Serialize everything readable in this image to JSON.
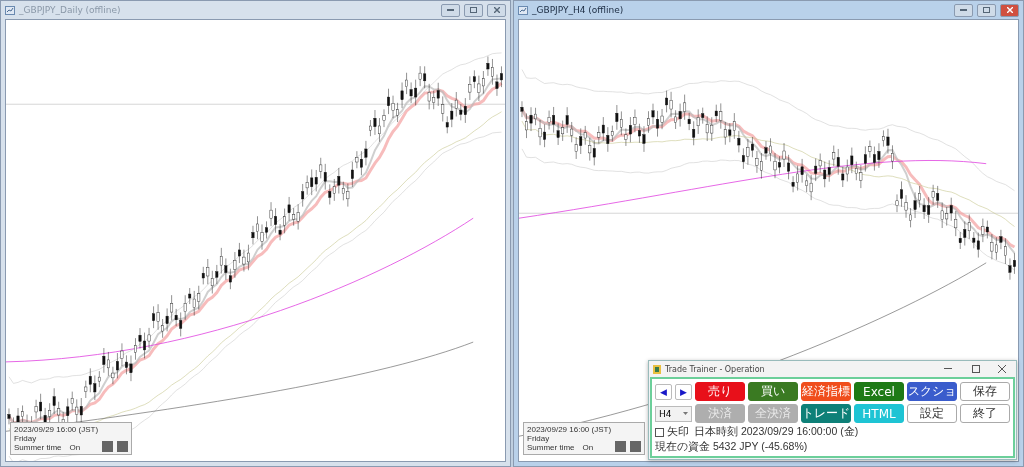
{
  "windows": [
    {
      "title": "_GBPJPY_Daily (offline)",
      "active": false,
      "info": {
        "date": "2023/09/29 16:00 (JST)",
        "day": "Friday",
        "summer_label": "Summer time",
        "summer_value": "On"
      }
    },
    {
      "title": "_GBPJPY_H4 (offline)",
      "active": true,
      "info": {
        "date": "2023/09/29 16:00 (JST)",
        "day": "Friday",
        "summer_label": "Summer time",
        "summer_value": "On"
      }
    }
  ],
  "dialog": {
    "title": "Trade Trainer - Operation",
    "nav": [
      {
        "label": "◀"
      },
      {
        "label": "▶"
      }
    ],
    "timeframe": "H4",
    "buttons": [
      {
        "label": "売り",
        "color": "#e8101a",
        "disabled": false
      },
      {
        "label": "買い",
        "color": "#3a7a22",
        "disabled": false
      },
      {
        "label": "経済指標",
        "color": "#f04e1c",
        "disabled": false
      },
      {
        "label": "Excel",
        "color": "#1e7a16",
        "disabled": false
      },
      {
        "label": "スクショ",
        "color": "#3a5ccc",
        "disabled": false
      },
      {
        "label": "保存",
        "color": "#ffffff",
        "disabled": false
      },
      {
        "label": "決済",
        "color": "#a0a0a0",
        "disabled": true
      },
      {
        "label": "全決済",
        "color": "#a0a0a0",
        "disabled": true
      },
      {
        "label": "トレード",
        "color": "#0e8078",
        "disabled": false
      },
      {
        "label": "HTML",
        "color": "#1ec4d4",
        "disabled": false
      },
      {
        "label": "設定",
        "color": "#ffffff",
        "disabled": false
      },
      {
        "label": "終了",
        "color": "#ffffff",
        "disabled": false
      }
    ],
    "arrow_checkbox": {
      "label": "矢印",
      "checked": false
    },
    "time_text": "日本時刻 2023/09/29 16:00:00 (金)",
    "funds_text": "現在の資金 5432 JPY (-45.68%)"
  }
}
